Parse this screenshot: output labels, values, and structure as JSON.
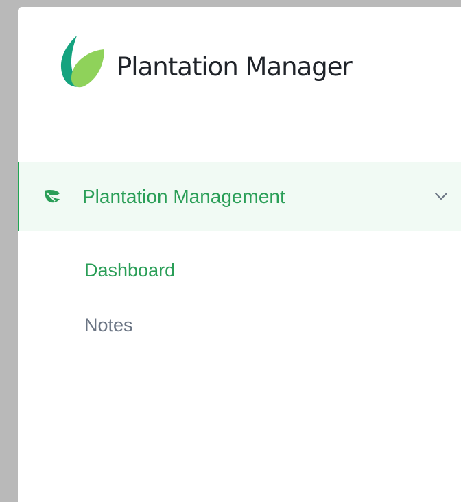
{
  "app": {
    "name": "Plantation Manager",
    "logo_icon": "leaf-logo-icon"
  },
  "colors": {
    "accent": "#2a9e57",
    "active_bg": "#f1faf4",
    "muted_text": "#6b7584",
    "logo_dark": "#15a37f",
    "logo_light": "#8fd25a"
  },
  "nav": {
    "group": {
      "label": "Plantation Management",
      "icon": "leaf-icon",
      "expanded": true,
      "chevron_icon": "chevron-down-icon"
    },
    "items": [
      {
        "label": "Dashboard",
        "active": true
      },
      {
        "label": "Notes",
        "active": false
      }
    ]
  }
}
